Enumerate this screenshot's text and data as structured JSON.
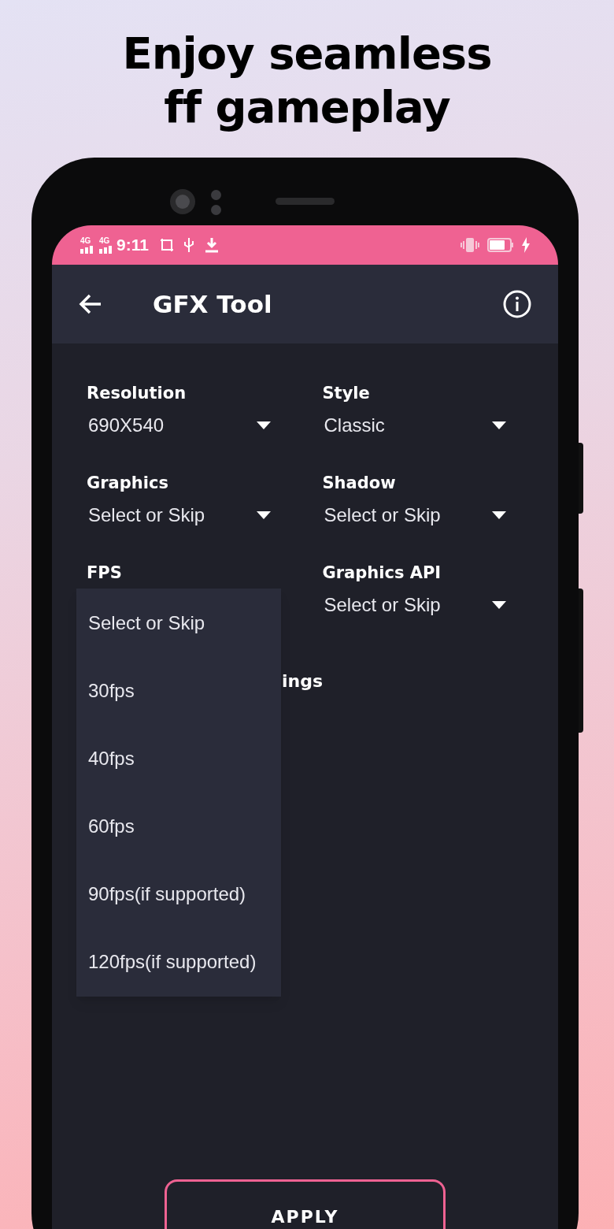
{
  "headline": [
    "Enjoy seamless",
    "ff gameplay"
  ],
  "status_bar": {
    "signals": [
      "4G",
      "4G"
    ],
    "time": "9:11"
  },
  "app_bar": {
    "title": "GFX Tool"
  },
  "fields": [
    {
      "label": "Resolution",
      "value": "690X540"
    },
    {
      "label": "Style",
      "value": "Classic"
    },
    {
      "label": "Graphics",
      "value": "Select or Skip"
    },
    {
      "label": "Shadow",
      "value": "Select or Skip"
    },
    {
      "label": "FPS"
    },
    {
      "label": "Graphics API",
      "value": "Select or Skip"
    }
  ],
  "section_heading": "ings",
  "dropdown": {
    "items": [
      "Select or Skip",
      "30fps",
      "40fps",
      "60fps",
      "90fps(if supported)",
      "120fps(if supported)"
    ]
  },
  "apply_button": "APPLY"
}
